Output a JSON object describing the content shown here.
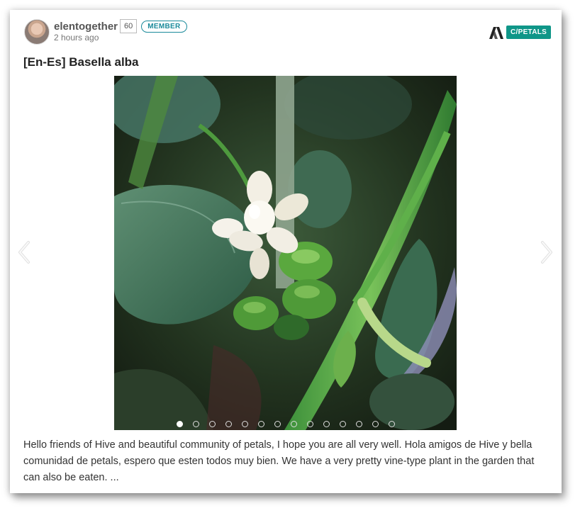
{
  "post": {
    "author": {
      "name": "elentogether",
      "reputation": "60",
      "badge": "MEMBER",
      "avatar_icon": "user-avatar"
    },
    "timestamp": "2 hours ago",
    "community": {
      "tag": "C/PETALS",
      "logo_icon": "hive-logo-icon",
      "color": "#0f9688"
    },
    "title": "[En-Es] Basella alba",
    "carousel": {
      "slide_count": 14,
      "active_index": 0,
      "image_subject": "white basella alba flower buds with green leaves"
    },
    "excerpt": "Hello friends of Hive and beautiful community of petals, I hope you are all very well. Hola amigos de Hive y bella comunidad de petals, espero que esten todos muy bien. We have a very pretty vine-type plant in the garden that can also be eaten. ..."
  }
}
